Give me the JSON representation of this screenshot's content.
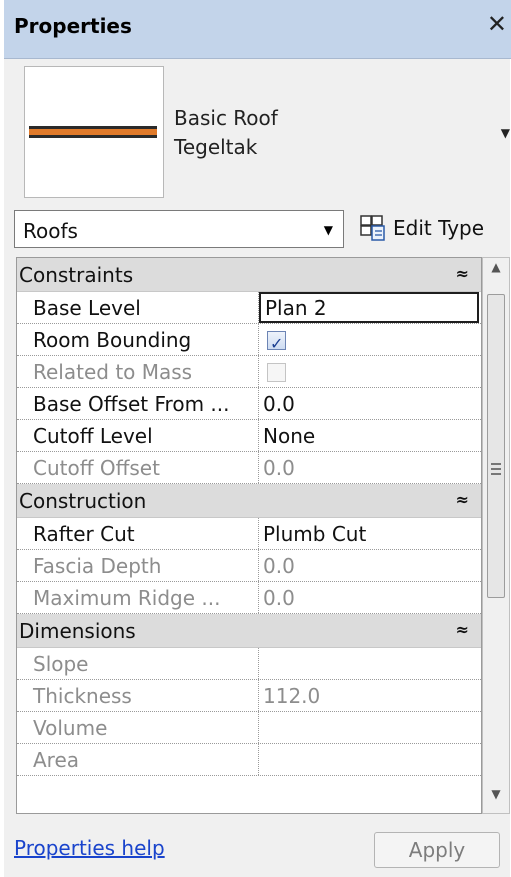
{
  "panel": {
    "title": "Properties",
    "close_glyph": "✕"
  },
  "type_selector": {
    "family": "Basic Roof",
    "type": "Tegeltak",
    "dropdown_glyph": "▼",
    "preview_colors": {
      "dark": "#2a2a2a",
      "accent": "#e07a2a"
    }
  },
  "category_filter": {
    "value": "Roofs",
    "dropdown_glyph": "▼"
  },
  "edit_type": {
    "label": "Edit Type",
    "icon": "edit-type-icon"
  },
  "groups": [
    {
      "name": "Constraints",
      "collapse_glyph": "≈",
      "rows": [
        {
          "label": "Base Level",
          "value": "Plan 2",
          "kind": "text",
          "dim": false,
          "active": true
        },
        {
          "label": "Room Bounding",
          "value": "",
          "kind": "checkbox",
          "checked": true,
          "dim": false,
          "active": false
        },
        {
          "label": "Related to Mass",
          "value": "",
          "kind": "checkbox",
          "checked": false,
          "dim": true,
          "active": false
        },
        {
          "label": "Base Offset From ...",
          "value": "0.0",
          "kind": "text",
          "dim": false,
          "active": false
        },
        {
          "label": "Cutoff Level",
          "value": "None",
          "kind": "text",
          "dim": false,
          "active": false
        },
        {
          "label": "Cutoff Offset",
          "value": "0.0",
          "kind": "text",
          "dim": true,
          "active": false
        }
      ]
    },
    {
      "name": "Construction",
      "collapse_glyph": "≈",
      "rows": [
        {
          "label": "Rafter Cut",
          "value": "Plumb Cut",
          "kind": "text",
          "dim": false,
          "active": false
        },
        {
          "label": "Fascia Depth",
          "value": "0.0",
          "kind": "text",
          "dim": true,
          "active": false
        },
        {
          "label": "Maximum Ridge ...",
          "value": "0.0",
          "kind": "text",
          "dim": true,
          "active": false
        }
      ]
    },
    {
      "name": "Dimensions",
      "collapse_glyph": "≈",
      "rows": [
        {
          "label": "Slope",
          "value": "",
          "kind": "text",
          "dim": true,
          "active": false
        },
        {
          "label": "Thickness",
          "value": "112.0",
          "kind": "text",
          "dim": true,
          "active": false
        },
        {
          "label": "Volume",
          "value": "",
          "kind": "text",
          "dim": true,
          "active": false
        },
        {
          "label": "Area",
          "value": "",
          "kind": "text",
          "dim": true,
          "active": false
        }
      ]
    }
  ],
  "scrollbar": {
    "up_glyph": "▲",
    "down_glyph": "▼"
  },
  "footer": {
    "help_link": "Properties help",
    "apply_label": "Apply"
  }
}
